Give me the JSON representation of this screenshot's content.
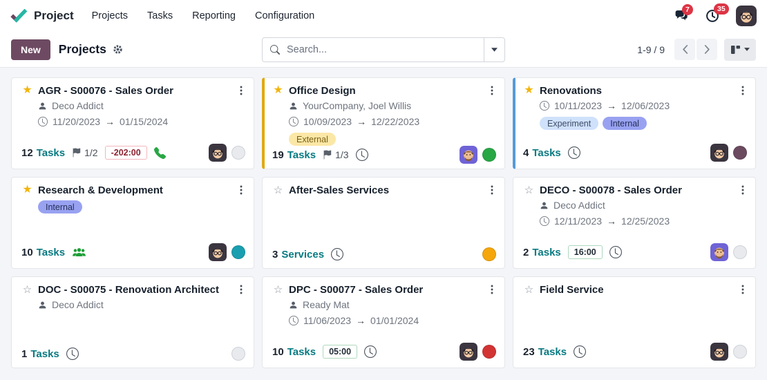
{
  "nav": {
    "brand": "Project",
    "items": [
      "Projects",
      "Tasks",
      "Reporting",
      "Configuration"
    ],
    "chat_badge": "7",
    "activity_badge": "35"
  },
  "control": {
    "new_label": "New",
    "title": "Projects",
    "search_placeholder": "Search...",
    "pager": "1-9 / 9"
  },
  "glyphs": {
    "star_filled": "★",
    "star_outline": "☆",
    "arrow": "→"
  },
  "colors": {
    "primary_button": "#6e4a62",
    "star_gold": "#f2b50d",
    "link_teal": "#077a81",
    "badge_red": "#dc3545",
    "kanban_background": "#f4f5f8"
  },
  "cards": [
    {
      "title": "AGR - S00076 - Sales Order",
      "starred": true,
      "accent": null,
      "customer": "Deco Addict",
      "dates": {
        "start": "11/20/2023",
        "end": "01/15/2024"
      },
      "tags": [],
      "count": "12",
      "count_label": "Tasks",
      "flag": "1/2",
      "badge": {
        "text": "-202:00",
        "style": "danger"
      },
      "icon": "phone",
      "avatar": "glasses",
      "status": null,
      "status_empty": true
    },
    {
      "title": "Office Design",
      "starred": true,
      "accent": "#e0a90f",
      "customer": "YourCompany, Joel Willis",
      "dates": {
        "start": "10/09/2023",
        "end": "12/22/2023"
      },
      "tags": [
        {
          "label": "External",
          "bg": "#fbe7a6",
          "fg": "#7a6017"
        }
      ],
      "count": "19",
      "count_label": "Tasks",
      "flag": "1/3",
      "badge": null,
      "icon": "clock",
      "avatar": "beard",
      "status": "#28a745",
      "status_empty": false
    },
    {
      "title": "Renovations",
      "starred": true,
      "accent": "#549bd9",
      "customer": null,
      "dates": {
        "start": "10/11/2023",
        "end": "12/06/2023"
      },
      "tags": [
        {
          "label": "Experiment",
          "bg": "#cfe1fb",
          "fg": "#3e4c68"
        },
        {
          "label": "Internal",
          "bg": "#98a2f1",
          "fg": "#252f58"
        }
      ],
      "count": "4",
      "count_label": "Tasks",
      "flag": null,
      "badge": null,
      "icon": "clock",
      "avatar": "glasses",
      "status": "#6b4a60",
      "status_empty": false
    },
    {
      "title": "Research & Development",
      "starred": true,
      "accent": null,
      "customer": null,
      "dates": null,
      "tags": [
        {
          "label": "Internal",
          "bg": "#98a2f1",
          "fg": "#252f58"
        }
      ],
      "count": "10",
      "count_label": "Tasks",
      "flag": null,
      "badge": null,
      "icon": "people",
      "avatar": "glasses",
      "status": "#1a9fb0",
      "status_empty": false
    },
    {
      "title": "After-Sales Services",
      "starred": false,
      "accent": null,
      "customer": null,
      "dates": null,
      "tags": [],
      "count": "3",
      "count_label": "Services",
      "flag": null,
      "badge": null,
      "icon": "clock",
      "avatar": null,
      "status": "#f5a60b",
      "status_empty": false
    },
    {
      "title": "DECO - S00078 - Sales Order",
      "starred": false,
      "accent": null,
      "customer": "Deco Addict",
      "dates": {
        "start": "12/11/2023",
        "end": "12/25/2023"
      },
      "tags": [],
      "count": "2",
      "count_label": "Tasks",
      "flag": null,
      "badge": {
        "text": "16:00",
        "style": "success"
      },
      "icon": "clock",
      "avatar": "beard",
      "status": null,
      "status_empty": true
    },
    {
      "title": "DOC - S00075 - Renovation Architect",
      "starred": false,
      "accent": null,
      "customer": "Deco Addict",
      "dates": null,
      "tags": [],
      "count": "1",
      "count_label": "Tasks",
      "flag": null,
      "badge": null,
      "icon": "clock",
      "avatar": null,
      "status": null,
      "status_empty": true
    },
    {
      "title": "DPC - S00077 - Sales Order",
      "starred": false,
      "accent": null,
      "customer": "Ready Mat",
      "dates": {
        "start": "11/06/2023",
        "end": "01/01/2024"
      },
      "tags": [],
      "count": "10",
      "count_label": "Tasks",
      "flag": null,
      "badge": {
        "text": "05:00",
        "style": "success"
      },
      "icon": "clock",
      "avatar": "glasses",
      "status": "#d23434",
      "status_empty": false
    },
    {
      "title": "Field Service",
      "starred": false,
      "accent": null,
      "customer": null,
      "dates": null,
      "tags": [],
      "count": "23",
      "count_label": "Tasks",
      "flag": null,
      "badge": null,
      "icon": "clock",
      "avatar": "glasses",
      "status": null,
      "status_empty": true
    }
  ]
}
